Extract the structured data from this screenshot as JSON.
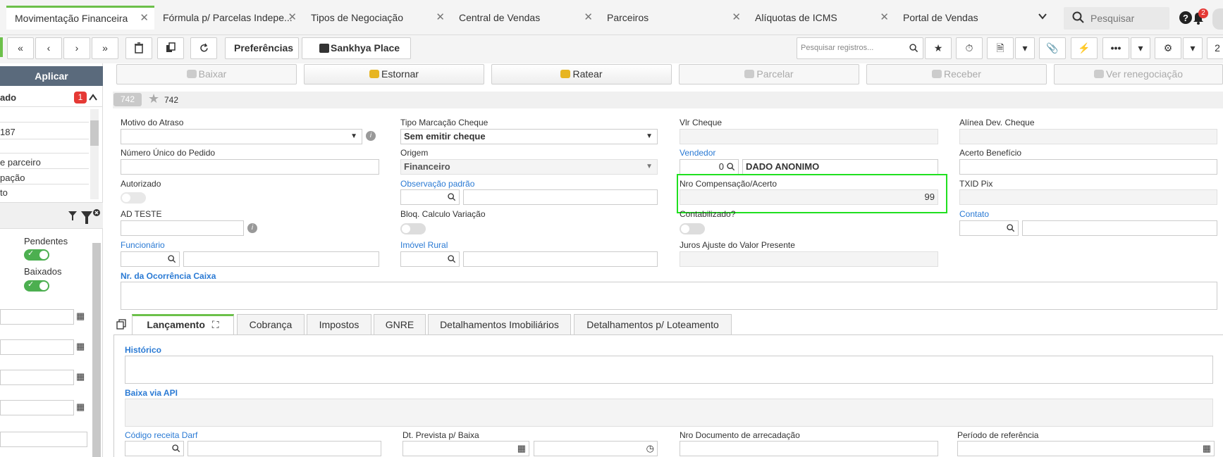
{
  "tabs": [
    {
      "label": "Movimentação Financeira"
    },
    {
      "label": "Fórmula p/ Parcelas Indepe..."
    },
    {
      "label": "Tipos de Negociação"
    },
    {
      "label": "Central de Vendas"
    },
    {
      "label": "Parceiros"
    },
    {
      "label": "Alíquotas de ICMS"
    },
    {
      "label": "Portal de Vendas"
    }
  ],
  "topbar": {
    "search_placeholder": "Pesquisar",
    "notif_count": "2"
  },
  "toolbar": {
    "prefs": "Preferências",
    "place": "Sankhya Place",
    "search_placeholder": "Pesquisar registros...",
    "page": "2"
  },
  "actions": {
    "baixar": "Baixar",
    "estornar": "Estornar",
    "ratear": "Ratear",
    "parcelar": "Parcelar",
    "receber": "Receber",
    "ver_reneg": "Ver renegociação"
  },
  "left": {
    "apply": "Aplicar",
    "section": "ado",
    "section_count": "1",
    "value1": "187",
    "item1": "e parceiro",
    "item2": "pação",
    "item3": "to",
    "pendentes": "Pendentes",
    "baixados": "Baixados"
  },
  "record": {
    "id_badge": "742",
    "id": "742"
  },
  "form": {
    "motivo_atraso": "Motivo do Atraso",
    "tipo_marcacao": "Tipo Marcação Cheque",
    "tipo_marcacao_val": "Sem emitir cheque",
    "vlr_cheque": "Vlr Cheque",
    "alinea": "Alínea Dev. Cheque",
    "num_unico": "Número Único do Pedido",
    "origem": "Origem",
    "origem_val": "Financeiro",
    "vendedor": "Vendedor",
    "vendedor_cod": "0",
    "vendedor_nome": "DADO ANONIMO",
    "acerto": "Acerto Benefício",
    "autorizado": "Autorizado",
    "obs_padrao": "Observação padrão",
    "nro_comp": "Nro Compensação/Acerto",
    "nro_comp_val": "99",
    "txid": "TXID Pix",
    "ad_teste": "AD TESTE",
    "bloq": "Bloq. Calculo Variação",
    "contabilizado": "Contabilizado?",
    "contato": "Contato",
    "funcionario": "Funcionário",
    "imovel": "Imóvel Rural",
    "juros": "Juros Ajuste do Valor Presente",
    "nr_ocorrencia": "Nr. da Ocorrência Caixa"
  },
  "subtabs": [
    {
      "label": "Lançamento"
    },
    {
      "label": "Cobrança"
    },
    {
      "label": "Impostos"
    },
    {
      "label": "GNRE"
    },
    {
      "label": "Detalhamentos Imobiliários"
    },
    {
      "label": "Detalhamentos p/ Loteamento"
    }
  ],
  "lanc": {
    "historico": "Histórico",
    "baixa_api": "Baixa via API",
    "cod_darf": "Código receita Darf",
    "dt_prevista": "Dt. Prevista p/ Baixa",
    "nro_doc": "Nro Documento de arrecadação",
    "periodo": "Período de referência"
  },
  "colors": {
    "accent": "#6cc04a",
    "link": "#2a7ad4",
    "highlight": "#20e020",
    "badge": "#e53935"
  }
}
